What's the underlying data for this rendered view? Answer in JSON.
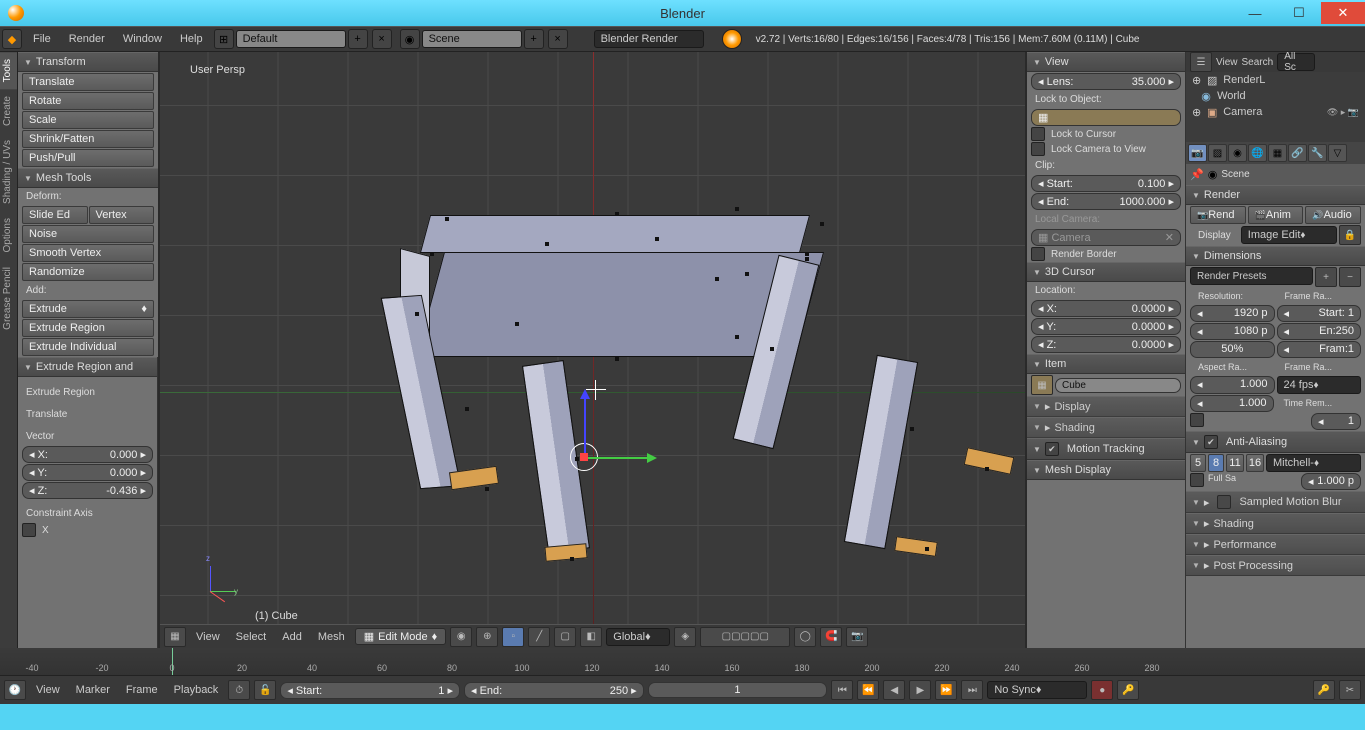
{
  "window_title": "Blender",
  "menubar": {
    "file": "File",
    "render": "Render",
    "window": "Window",
    "help": "Help",
    "layout": "Default",
    "scene": "Scene",
    "engine": "Blender Render"
  },
  "stats": "v2.72 | Verts:16/80 | Edges:16/156 | Faces:4/78 | Tris:156 | Mem:7.60M (0.11M) | Cube",
  "lefttabs": [
    "Tools",
    "Create",
    "Shading / UVs",
    "Options",
    "Grease Pencil"
  ],
  "transform": {
    "title": "Transform",
    "translate": "Translate",
    "rotate": "Rotate",
    "scale": "Scale",
    "shrink": "Shrink/Fatten",
    "push": "Push/Pull"
  },
  "meshtools": {
    "title": "Mesh Tools",
    "deform": "Deform:",
    "slide": "Slide Ed",
    "vertex": "Vertex",
    "noise": "Noise",
    "smooth": "Smooth Vertex",
    "random": "Randomize",
    "add": "Add:",
    "extrude": "Extrude",
    "extReg": "Extrude Region",
    "extInd": "Extrude Individual"
  },
  "operator": {
    "title": "Extrude Region and",
    "name": "Extrude Region",
    "translate": "Translate",
    "vector": "Vector",
    "x": "X:",
    "xv": "0.000",
    "y": "Y:",
    "yv": "0.000",
    "z": "Z:",
    "zv": "-0.436",
    "caxis": "Constraint Axis",
    "cx": "X"
  },
  "viewport": {
    "persp": "User Persp",
    "obj": "(1) Cube",
    "menu": {
      "view": "View",
      "select": "Select",
      "add": "Add",
      "mesh": "Mesh"
    },
    "mode": "Edit Mode",
    "orient": "Global"
  },
  "nprops": {
    "view": "View",
    "lens_l": "Lens:",
    "lens_v": "35.000",
    "lockobj": "Lock to Object:",
    "lockcur": "Lock to Cursor",
    "lockcam": "Lock Camera to View",
    "clip": "Clip:",
    "start_l": "Start:",
    "start_v": "0.100",
    "end_l": "End:",
    "end_v": "1000.000",
    "localcam": "Local Camera:",
    "camera": "Camera",
    "rborder": "Render Border",
    "cursor": "3D Cursor",
    "location": "Location:",
    "cx": "X:",
    "cxv": "0.0000",
    "cy": "Y:",
    "cyv": "0.0000",
    "cz": "Z:",
    "czv": "0.0000",
    "item": "Item",
    "itemname": "Cube",
    "display": "Display",
    "shading": "Shading",
    "motion": "Motion Tracking",
    "meshdisp": "Mesh Display"
  },
  "outliner": {
    "view": "View",
    "search": "Search",
    "all": "All Sc",
    "items": [
      "RenderL",
      "World",
      "Camera"
    ]
  },
  "scene_crumb": "Scene",
  "props": {
    "render": "Render",
    "rend": "Rend",
    "anim": "Anim",
    "audio": "Audio",
    "display": "Display",
    "imgedit": "Image Edit",
    "dims": "Dimensions",
    "presets": "Render Presets",
    "res": "Resolution:",
    "framer": "Frame Ra...",
    "rx": "1920 p",
    "sx": "Start: 1",
    "ry": "1080 p",
    "ex": "En:250",
    "pct": "50%",
    "fr": "Fram:1",
    "aspect": "Aspect Ra...",
    "frate": "Frame Ra...",
    "a1": "1.000",
    "fps": "24 fps",
    "a2": "1.000",
    "trem": "Time Rem...",
    "one": "1",
    "aa": "Anti-Aliasing",
    "aa5": "5",
    "aa8": "8",
    "aa11": "11",
    "aa16": "16",
    "filter": "Mitchell-",
    "fullsa": "Full Sa",
    "px": "1.000 p",
    "smb": "Sampled Motion Blur",
    "shad": "Shading",
    "perf": "Performance",
    "post": "Post Processing"
  },
  "timeline": {
    "ticks": [
      "-40",
      "-20",
      "0",
      "20",
      "40",
      "60",
      "80",
      "100",
      "120",
      "140",
      "160",
      "180",
      "200",
      "220",
      "240",
      "260",
      "280"
    ],
    "view": "View",
    "marker": "Marker",
    "frame": "Frame",
    "playback": "Playback",
    "start_l": "Start:",
    "start_v": "1",
    "end_l": "End:",
    "end_v": "250",
    "cur": "1",
    "sync": "No Sync"
  }
}
